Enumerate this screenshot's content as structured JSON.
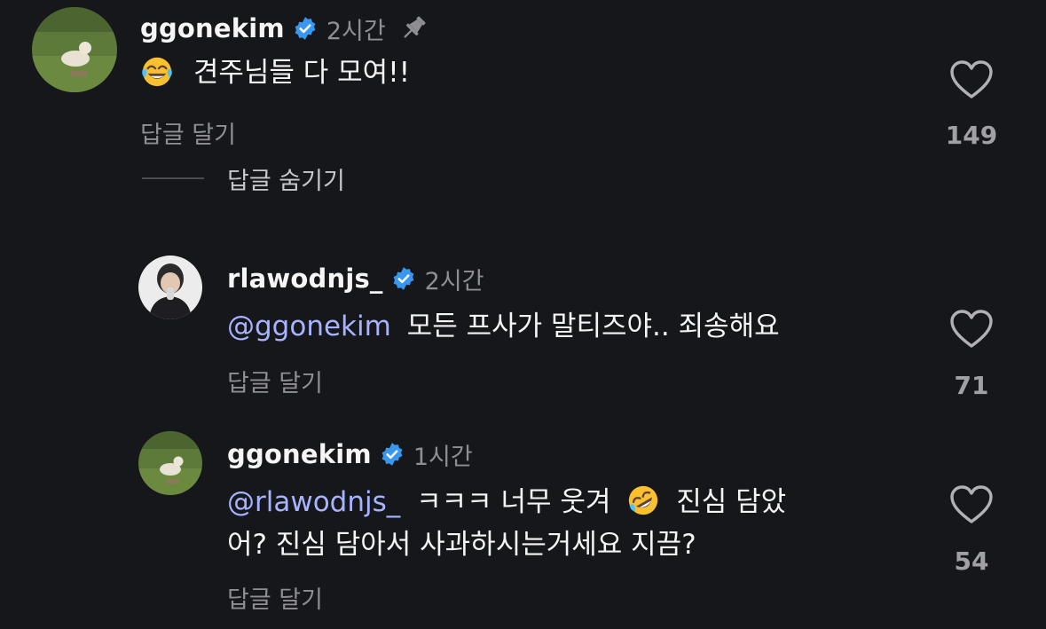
{
  "comments": [
    {
      "username": "ggonekim",
      "time": "2시간",
      "pinned": true,
      "text_before_emoji": "",
      "emoji": "face-with-tears-of-joy",
      "text_after_emoji": "견주님들 다 모여!!",
      "reply_label": "답글 달기",
      "likes": "149"
    },
    {
      "username": "rlawodnjs_",
      "time": "2시간",
      "mention": "@ggonekim",
      "text": "모든 프사가 말티즈야.. 죄송해요",
      "reply_label": "답글 달기",
      "likes": "71"
    },
    {
      "username": "ggonekim",
      "time": "1시간",
      "mention": "@rlawodnjs_",
      "text_line1_before_emoji": "ㅋㅋㅋ 너무 웃겨",
      "emoji": "rolling-on-the-floor-laughing",
      "text_line1_after_emoji": "진심 담았",
      "text_line2": "어? 진심 담아서 사과하시는거세요 지끔?",
      "reply_label": "답글 달기",
      "likes": "54"
    }
  ],
  "hide_replies_label": "답글 숨기기",
  "colors": {
    "background": "#16171b",
    "text": "#f5f5f5",
    "secondary": "#8e8e93",
    "mention": "#a8b3ff",
    "verified": "#3897f0"
  }
}
